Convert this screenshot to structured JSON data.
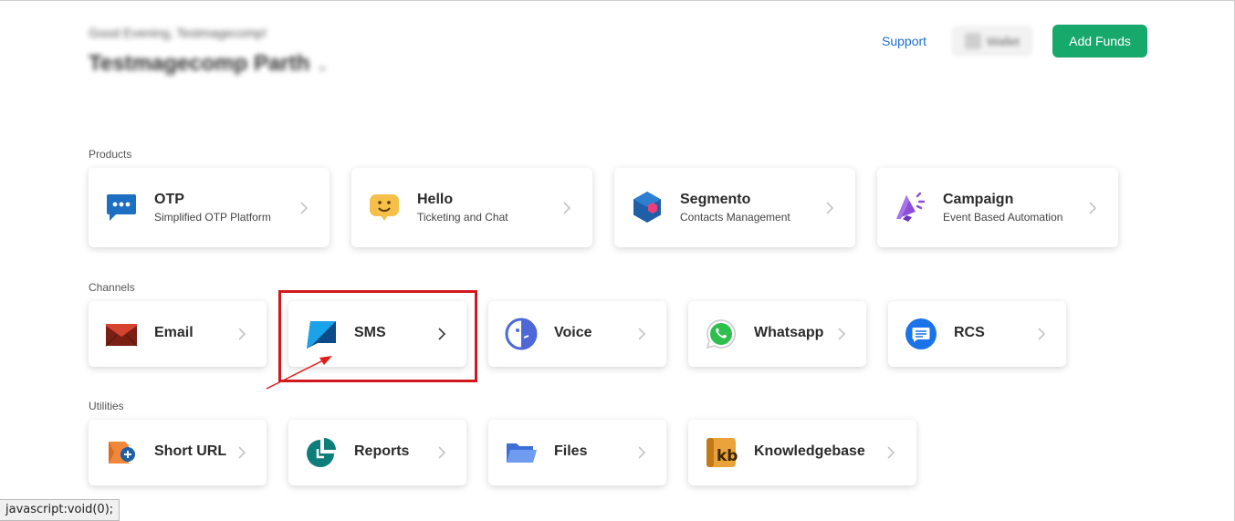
{
  "header": {
    "greeting": "Good Evening, Testmagecomp!",
    "company": "Testmagecomp Parth",
    "support_label": "Support",
    "wallet_label": "Wallet",
    "add_funds_label": "Add Funds"
  },
  "colors": {
    "accent_green": "#17a86b",
    "link_blue": "#1a6fd0",
    "highlight_red": "#d0181c"
  },
  "sections": {
    "products": {
      "label": "Products",
      "items": [
        {
          "title": "OTP",
          "subtitle": "Simplified OTP Platform",
          "icon": "otp-chat-icon"
        },
        {
          "title": "Hello",
          "subtitle": "Ticketing and Chat",
          "icon": "hello-smile-icon"
        },
        {
          "title": "Segmento",
          "subtitle": "Contacts Management",
          "icon": "segmento-hexagon-icon"
        },
        {
          "title": "Campaign",
          "subtitle": "Event Based Automation",
          "icon": "campaign-megaphone-icon"
        }
      ]
    },
    "channels": {
      "label": "Channels",
      "items": [
        {
          "title": "Email",
          "icon": "email-envelope-icon"
        },
        {
          "title": "SMS",
          "icon": "sms-icon"
        },
        {
          "title": "Voice",
          "icon": "voice-icon"
        },
        {
          "title": "Whatsapp",
          "icon": "whatsapp-icon"
        },
        {
          "title": "RCS",
          "icon": "rcs-message-icon"
        }
      ]
    },
    "utilities": {
      "label": "Utilities",
      "items": [
        {
          "title": "Short URL",
          "icon": "short-url-icon"
        },
        {
          "title": "Reports",
          "icon": "reports-icon"
        },
        {
          "title": "Files",
          "icon": "folder-icon"
        },
        {
          "title": "Knowledgebase",
          "icon": "knowledgebase-icon"
        }
      ]
    }
  },
  "statusbar": {
    "text": "javascript:void(0);"
  }
}
